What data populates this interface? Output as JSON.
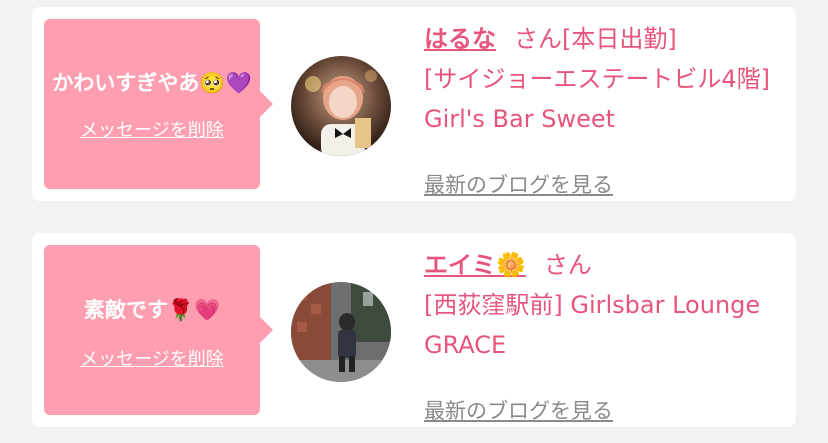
{
  "cards": [
    {
      "message": "かわいすぎやあ🥺💜",
      "delete_label": "メッセージを削除",
      "name": "はるな",
      "honorific": "さん",
      "status": "[本日出勤]",
      "shop": "[サイジョーエステートビル4階] Girl's Bar Sweet",
      "blog_label": "最新のブログを見る",
      "accent_color": "#ff9eb0"
    },
    {
      "message": "素敵です🌹💗",
      "delete_label": "メッセージを削除",
      "name": "エイミ🌼",
      "honorific": "さん",
      "status": "",
      "shop": "[西荻窪駅前] Girlsbar Lounge GRACE",
      "blog_label": "最新のブログを見る",
      "accent_color": "#ff9eb0"
    }
  ],
  "colors": {
    "name_pink": "#e8557c",
    "link_gray": "#8a8a8a",
    "background": "#f2f2f4"
  }
}
